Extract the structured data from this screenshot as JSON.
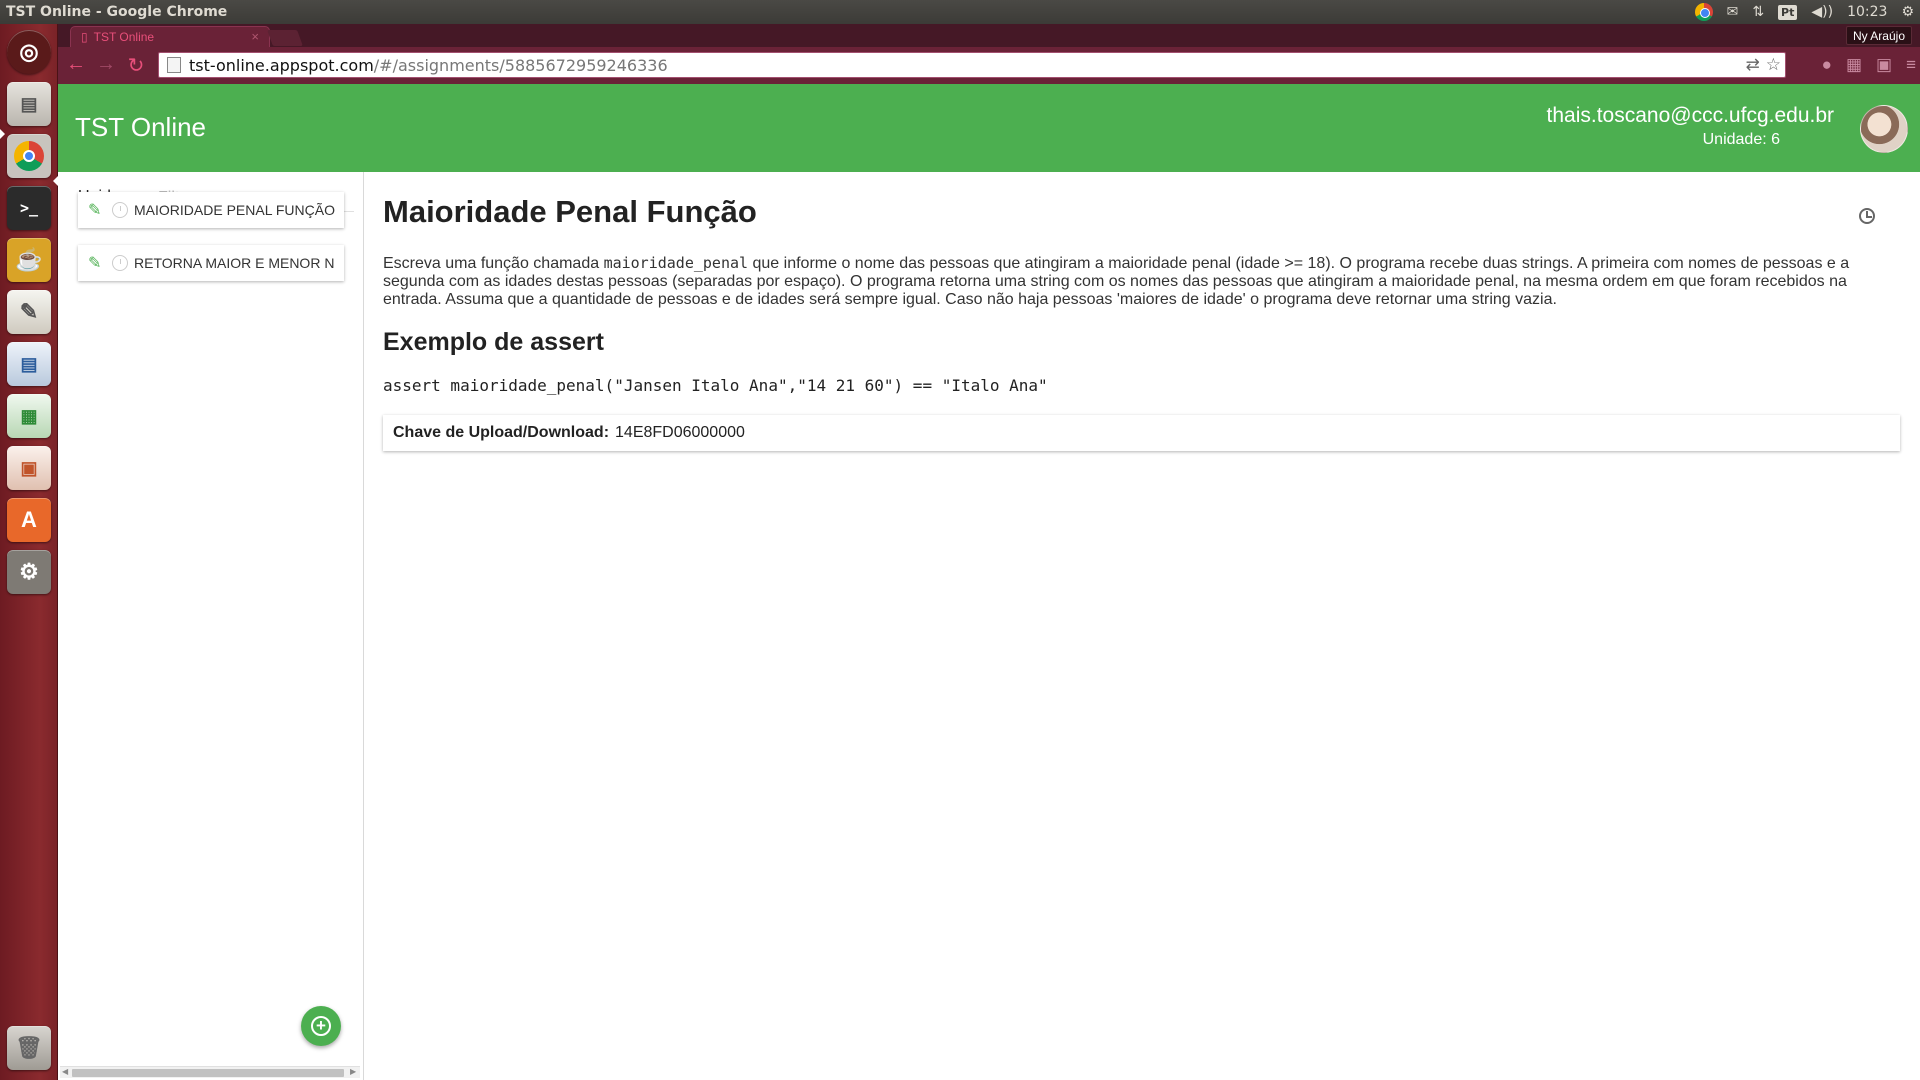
{
  "os": {
    "window_title": "TST Online - Google Chrome",
    "time": "10:23",
    "keyboard": "Pt",
    "volume": "◀))",
    "network": "⇅"
  },
  "browser": {
    "tab_title": "TST Online",
    "tab_close": "×",
    "user_badge": "Ny Araújo",
    "url_host": "tst-online.appspot.com",
    "url_path": "/#/assignments/5885672959246336",
    "back": "←",
    "forward": "→",
    "reload": "↻"
  },
  "header": {
    "app_title": "TST Online",
    "email": "thais.toscano@ccc.ufcg.edu.br",
    "unit": "Unidade: 6"
  },
  "sidebar": {
    "unit_label": "Unid.",
    "filter_placeholder": "Filtro",
    "items": [
      {
        "label": "MAIORIDADE PENAL FUNÇÃO",
        "edit_icon": "✎"
      },
      {
        "label": "RETORNA MAIOR E MENOR N",
        "edit_icon": "✎"
      }
    ],
    "add_label": "+"
  },
  "main": {
    "title": "Maioridade Penal Função",
    "desc_before": "Escreva uma função chamada ",
    "desc_code": "maioridade_penal",
    "desc_after": " que informe o nome das pessoas que atingiram a maioridade penal (idade >= 18). O programa recebe duas strings. A primeira com nomes de pessoas e a segunda com as idades destas pessoas (separadas por espaço). O programa retorna uma string com os nomes das pessoas que atingiram a maioridade penal, na mesma ordem em que foram recebidos na entrada. Assuma que a quantidade de pessoas e de idades será sempre igual. Caso não haja pessoas 'maiores de idade' o programa deve retornar uma string vazia.",
    "example_heading": "Exemplo de assert",
    "assert_code": "assert maioridade_penal(\"Jansen Italo Ana\",\"14 21 60\") == \"Italo Ana\"",
    "key_label": "Chave de Upload/Download:",
    "key_value": "14E8FD06000000"
  },
  "launcher": {
    "icons": [
      "ubuntu-dash-icon",
      "files-icon",
      "chrome-icon",
      "terminal-icon",
      "teapot-icon",
      "text-editor-icon",
      "writer-icon",
      "calc-icon",
      "impress-icon",
      "software-center-icon",
      "system-settings-icon",
      "trash-icon"
    ]
  }
}
